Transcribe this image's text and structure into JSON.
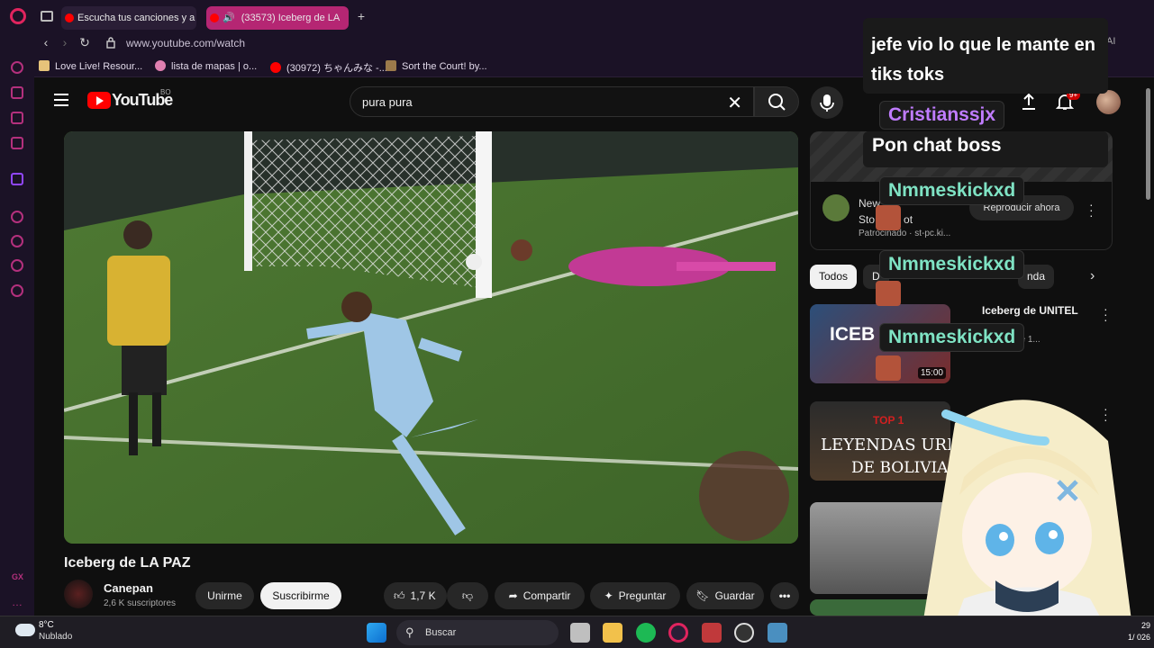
{
  "browser": {
    "tabs": [
      {
        "label": "Escucha tus canciones y a"
      },
      {
        "label": "(33573) Iceberg de LA"
      }
    ],
    "url": "www.youtube.com/watch",
    "bookmarks": [
      {
        "label": "Love Live! Resour...",
        "icon": "bookmark-favicon"
      },
      {
        "label": "lista de mapas | o...",
        "icon": "bookmark-favicon"
      },
      {
        "label": "(30972) ちゃんみな -...",
        "icon": "youtube-icon"
      },
      {
        "label": "Sort the Court! by...",
        "icon": "game-icon"
      }
    ],
    "sidebar_bottom": "GX",
    "ai_label": "AI"
  },
  "youtube": {
    "logo_text": "YouTube",
    "country_code": "BO",
    "search_value": "pura pura",
    "notifications_badge": "9+",
    "video": {
      "title": "Iceberg de LA PAZ",
      "channel": "Canepan",
      "subscribers": "2,6 K suscriptores",
      "join_label": "Unirme",
      "subscribe_label": "Suscribirme",
      "likes": "1,7 K",
      "share_label": "Compartir",
      "ask_label": "Preguntar",
      "save_label": "Guardar"
    },
    "ad": {
      "title_line1": "New",
      "title_line2": "Sto",
      "title_suffix": "ot",
      "sponsor": "Patrocinado",
      "sponsor_domain": "st-pc.ki...",
      "play_label": "Reproducir ahora"
    },
    "chips": [
      {
        "label": "Todos",
        "active": true
      },
      {
        "label": "D",
        "active": false
      },
      {
        "label": "nda",
        "active": false
      }
    ],
    "related": [
      {
        "title": "Iceberg de UNITEL",
        "meta": "zaciones · hace 1...",
        "duration": "15:00",
        "thumb_text": "ICEB"
      },
      {
        "title": "",
        "meta": "",
        "duration": "",
        "thumb_text": "LEYENDAS URBAN"
      },
      {
        "title": "",
        "meta": "",
        "duration": "",
        "thumb_text": ""
      }
    ],
    "thumb2_sub": "DE BOLIVIA",
    "thumb2_top": "TOP 1"
  },
  "chat_overlay": {
    "messages": [
      {
        "name": "",
        "text": "jefe vio lo que le mante en tiks toks",
        "name_color": "#c07cff"
      },
      {
        "name": "Cristianssjx",
        "text": "Pon chat boss",
        "name_color": "#c07cff"
      },
      {
        "name": "Nmmeskickxd",
        "text": "",
        "name_color": "#7fe3c4"
      },
      {
        "name": "Nmmeskickxd",
        "text": "",
        "name_color": "#7fe3c4"
      },
      {
        "name": "Nmmeskickxd",
        "text": "",
        "name_color": "#7fe3c4"
      }
    ],
    "line1": "jefe vio lo que le mante en",
    "line2": "tiks toks"
  },
  "taskbar": {
    "temperature": "8°C",
    "weather": "Nublado",
    "search_label": "Buscar",
    "time": "29",
    "date": "1/  026"
  },
  "colors": {
    "youtube_red": "#ff0000",
    "opera_accent": "#b52673",
    "cristian_name": "#c07cff",
    "nmmes_name": "#7fe3c4"
  }
}
